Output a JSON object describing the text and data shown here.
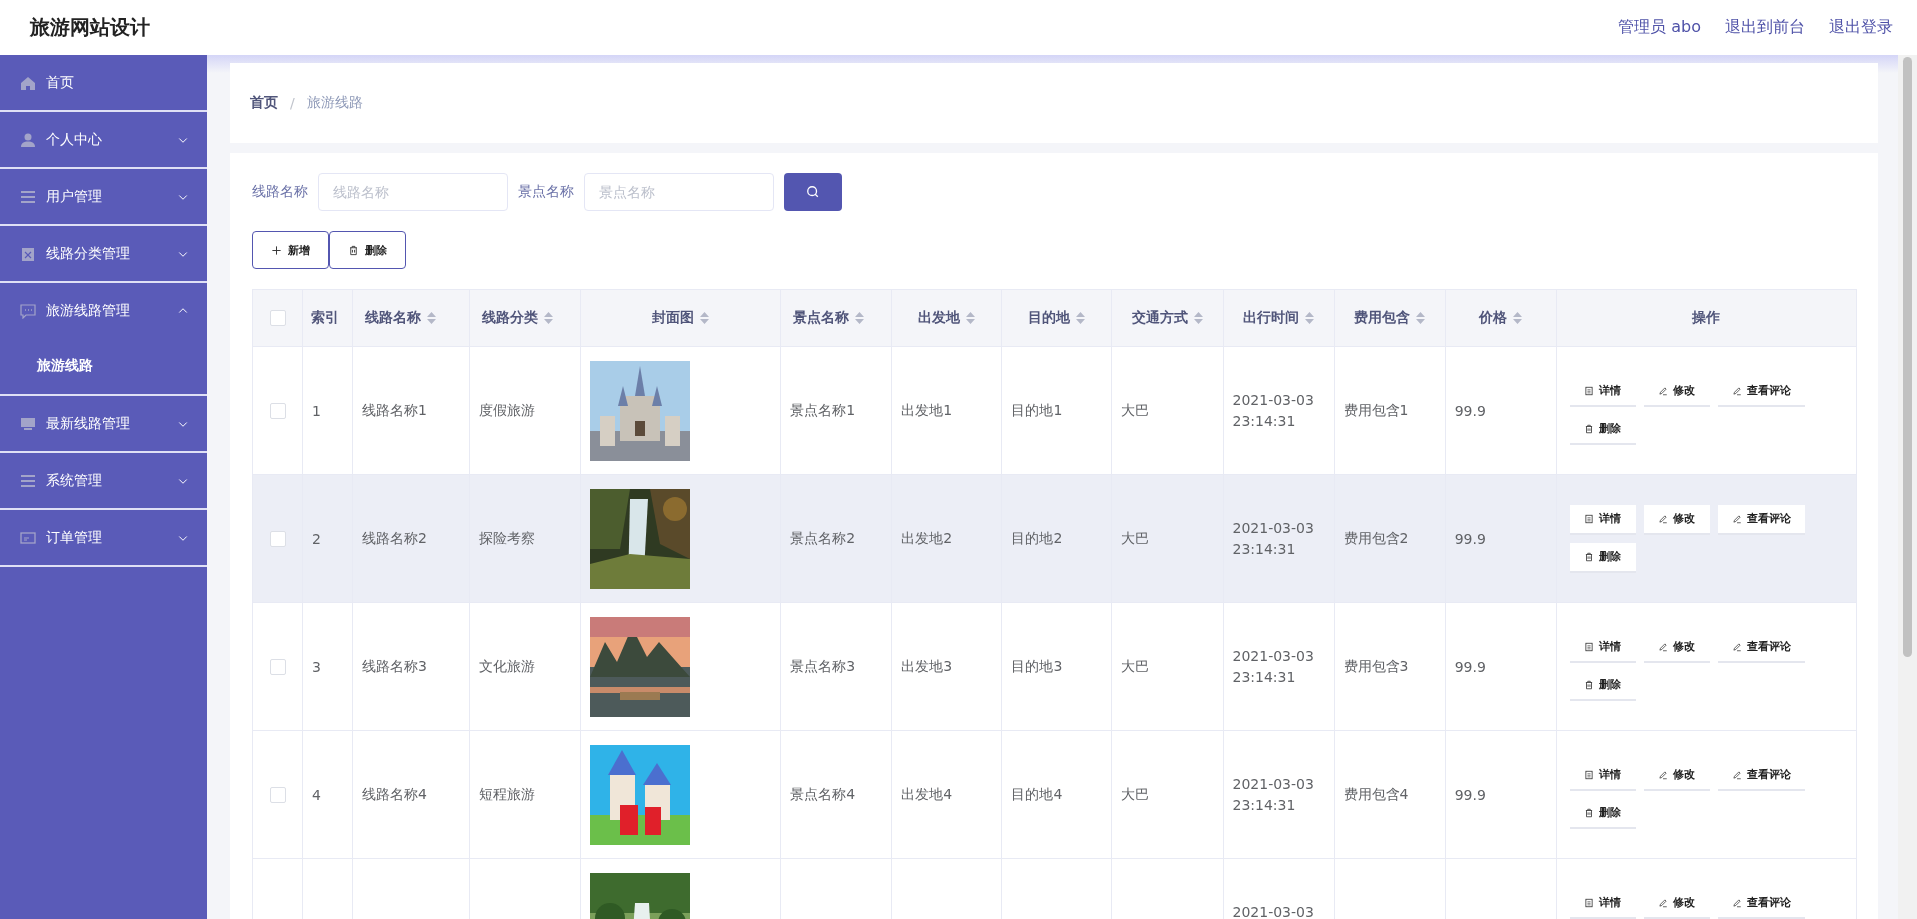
{
  "header": {
    "title": "旅游网站设计",
    "links": [
      {
        "label": "管理员 abo"
      },
      {
        "label": "退出到前台"
      },
      {
        "label": "退出登录"
      }
    ]
  },
  "sidebar": {
    "items": [
      {
        "label": "首页",
        "kind": "link"
      },
      {
        "label": "个人中心",
        "kind": "group",
        "expanded": false
      },
      {
        "label": "用户管理",
        "kind": "group",
        "expanded": false
      },
      {
        "label": "线路分类管理",
        "kind": "group",
        "expanded": false
      },
      {
        "label": "旅游线路管理",
        "kind": "group",
        "expanded": true,
        "children": [
          {
            "label": "旅游线路"
          }
        ]
      },
      {
        "label": "最新线路管理",
        "kind": "group",
        "expanded": false
      },
      {
        "label": "系统管理",
        "kind": "group",
        "expanded": false
      },
      {
        "label": "订单管理",
        "kind": "group",
        "expanded": false
      }
    ]
  },
  "breadcrumb": {
    "separator": "/",
    "items": [
      {
        "label": "首页",
        "current": false
      },
      {
        "label": "旅游线路",
        "current": true
      }
    ]
  },
  "search": {
    "fields": [
      {
        "label": "线路名称",
        "placeholder": "线路名称"
      },
      {
        "label": "景点名称",
        "placeholder": "景点名称"
      }
    ]
  },
  "toolbar": [
    {
      "label": "新增",
      "kind": "add"
    },
    {
      "label": "删除",
      "kind": "delete"
    }
  ],
  "table": {
    "header_checked": false,
    "columns": [
      {
        "label": "索引",
        "sortable": false
      },
      {
        "label": "线路名称",
        "sortable": true
      },
      {
        "label": "线路分类",
        "sortable": true
      },
      {
        "label": "封面图",
        "sortable": true
      },
      {
        "label": "景点名称",
        "sortable": true
      },
      {
        "label": "出发地",
        "sortable": true
      },
      {
        "label": "目的地",
        "sortable": true
      },
      {
        "label": "交通方式",
        "sortable": true
      },
      {
        "label": "出行时间",
        "sortable": true
      },
      {
        "label": "费用包含",
        "sortable": true
      },
      {
        "label": "价格",
        "sortable": true
      },
      {
        "label": "操作",
        "sortable": false
      }
    ],
    "rows": [
      {
        "checked": false,
        "highlighted": false,
        "index": "1",
        "route": "线路名称1",
        "category": "度假旅游",
        "cover": {
          "kind": "picture"
        },
        "spot": "景点名称1",
        "from": "出发地1",
        "to": "目的地1",
        "transport": "大巴",
        "date": "2021-03-03",
        "clock": "23:14:31",
        "fee": "费用包含1",
        "price": "99.9",
        "actions": [
          {
            "label": "详情",
            "kind": "detail"
          },
          {
            "label": "修改",
            "kind": "edit"
          },
          {
            "label": "查看评论",
            "kind": "comment"
          },
          {
            "label": "删除",
            "kind": "delete"
          }
        ]
      },
      {
        "checked": false,
        "highlighted": true,
        "index": "2",
        "route": "线路名称2",
        "category": "探险考察",
        "cover": {
          "kind": "picture"
        },
        "spot": "景点名称2",
        "from": "出发地2",
        "to": "目的地2",
        "transport": "大巴",
        "date": "2021-03-03",
        "clock": "23:14:31",
        "fee": "费用包含2",
        "price": "99.9",
        "actions": [
          {
            "label": "详情",
            "kind": "detail"
          },
          {
            "label": "修改",
            "kind": "edit"
          },
          {
            "label": "查看评论",
            "kind": "comment"
          },
          {
            "label": "删除",
            "kind": "delete"
          }
        ]
      },
      {
        "checked": false,
        "highlighted": false,
        "index": "3",
        "route": "线路名称3",
        "category": "文化旅游",
        "cover": {
          "kind": "picture"
        },
        "spot": "景点名称3",
        "from": "出发地3",
        "to": "目的地3",
        "transport": "大巴",
        "date": "2021-03-03",
        "clock": "23:14:31",
        "fee": "费用包含3",
        "price": "99.9",
        "actions": [
          {
            "label": "详情",
            "kind": "detail"
          },
          {
            "label": "修改",
            "kind": "edit"
          },
          {
            "label": "查看评论",
            "kind": "comment"
          },
          {
            "label": "删除",
            "kind": "delete"
          }
        ]
      },
      {
        "checked": false,
        "highlighted": false,
        "index": "4",
        "route": "线路名称4",
        "category": "短程旅游",
        "cover": {
          "kind": "picture"
        },
        "spot": "景点名称4",
        "from": "出发地4",
        "to": "目的地4",
        "transport": "大巴",
        "date": "2021-03-03",
        "clock": "23:14:31",
        "fee": "费用包含4",
        "price": "99.9",
        "actions": [
          {
            "label": "详情",
            "kind": "detail"
          },
          {
            "label": "修改",
            "kind": "edit"
          },
          {
            "label": "查看评论",
            "kind": "comment"
          },
          {
            "label": "删除",
            "kind": "delete"
          }
        ]
      },
      {
        "highlighted": false,
        "cover": {
          "kind": "picture"
        },
        "date": "2021-03-03",
        "actions": [
          {
            "label": "详情",
            "kind": "detail"
          },
          {
            "label": "修改",
            "kind": "edit"
          },
          {
            "label": "查看评论",
            "kind": "comment"
          }
        ]
      }
    ]
  }
}
